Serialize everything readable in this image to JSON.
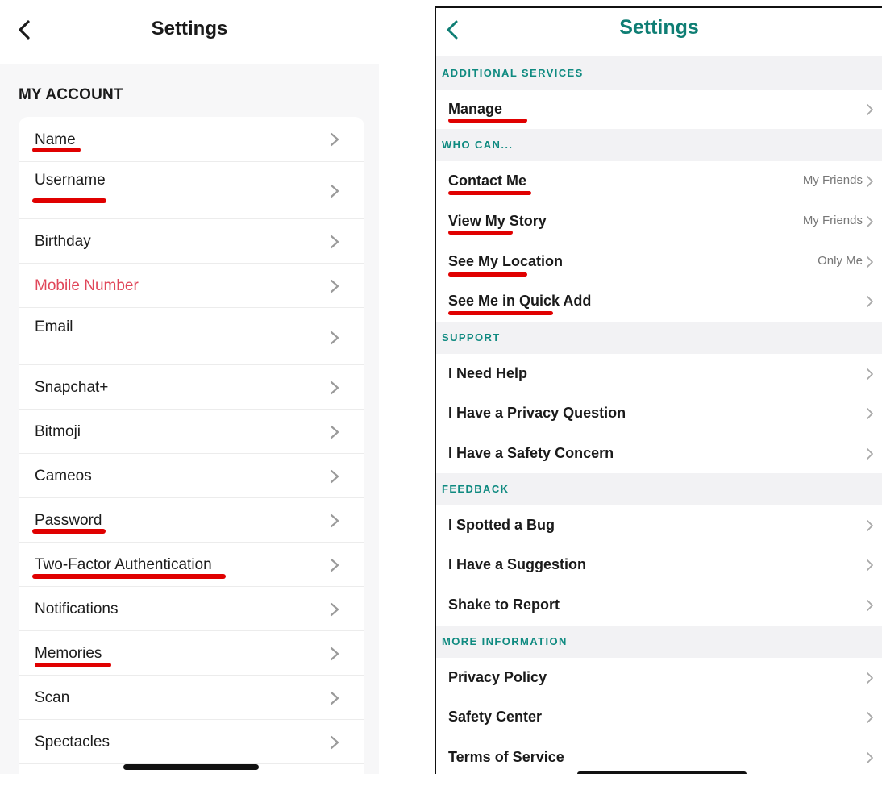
{
  "left": {
    "title": "Settings",
    "section": "MY ACCOUNT",
    "items": [
      {
        "label": "Name"
      },
      {
        "label": "Username"
      },
      {
        "label": "Birthday"
      },
      {
        "label": "Mobile Number"
      },
      {
        "label": "Email"
      },
      {
        "label": "Snapchat+"
      },
      {
        "label": "Bitmoji"
      },
      {
        "label": "Cameos"
      },
      {
        "label": "Password"
      },
      {
        "label": "Two-Factor Authentication"
      },
      {
        "label": "Notifications"
      },
      {
        "label": "Memories"
      },
      {
        "label": "Scan"
      },
      {
        "label": "Spectacles"
      }
    ]
  },
  "right": {
    "title": "Settings",
    "sections": [
      {
        "label": "ADDITIONAL SERVICES"
      },
      {
        "label": "WHO CAN..."
      },
      {
        "label": "SUPPORT"
      },
      {
        "label": "FEEDBACK"
      },
      {
        "label": "MORE INFORMATION"
      }
    ],
    "items": [
      {
        "label": "Manage",
        "value": ""
      },
      {
        "label": "Contact Me",
        "value": "My Friends"
      },
      {
        "label": "View My Story",
        "value": "My Friends"
      },
      {
        "label": "See My Location",
        "value": "Only Me"
      },
      {
        "label": "See Me in Quick Add",
        "value": ""
      },
      {
        "label": "I Need Help",
        "value": ""
      },
      {
        "label": "I Have a Privacy Question",
        "value": ""
      },
      {
        "label": "I Have a Safety Concern",
        "value": ""
      },
      {
        "label": "I Spotted a Bug",
        "value": ""
      },
      {
        "label": "I Have a Suggestion",
        "value": ""
      },
      {
        "label": "Shake to Report",
        "value": ""
      },
      {
        "label": "Privacy Policy",
        "value": ""
      },
      {
        "label": "Safety Center",
        "value": ""
      },
      {
        "label": "Terms of Service",
        "value": ""
      }
    ]
  },
  "colors": {
    "title_teal": "#0f7e74",
    "section_teal": "#0f8a80",
    "mobile_red": "#e0475a",
    "highlight_underline": "#e00000"
  },
  "icons": {
    "back": "chevron-left-icon",
    "row_arrow": "chevron-right-icon"
  }
}
